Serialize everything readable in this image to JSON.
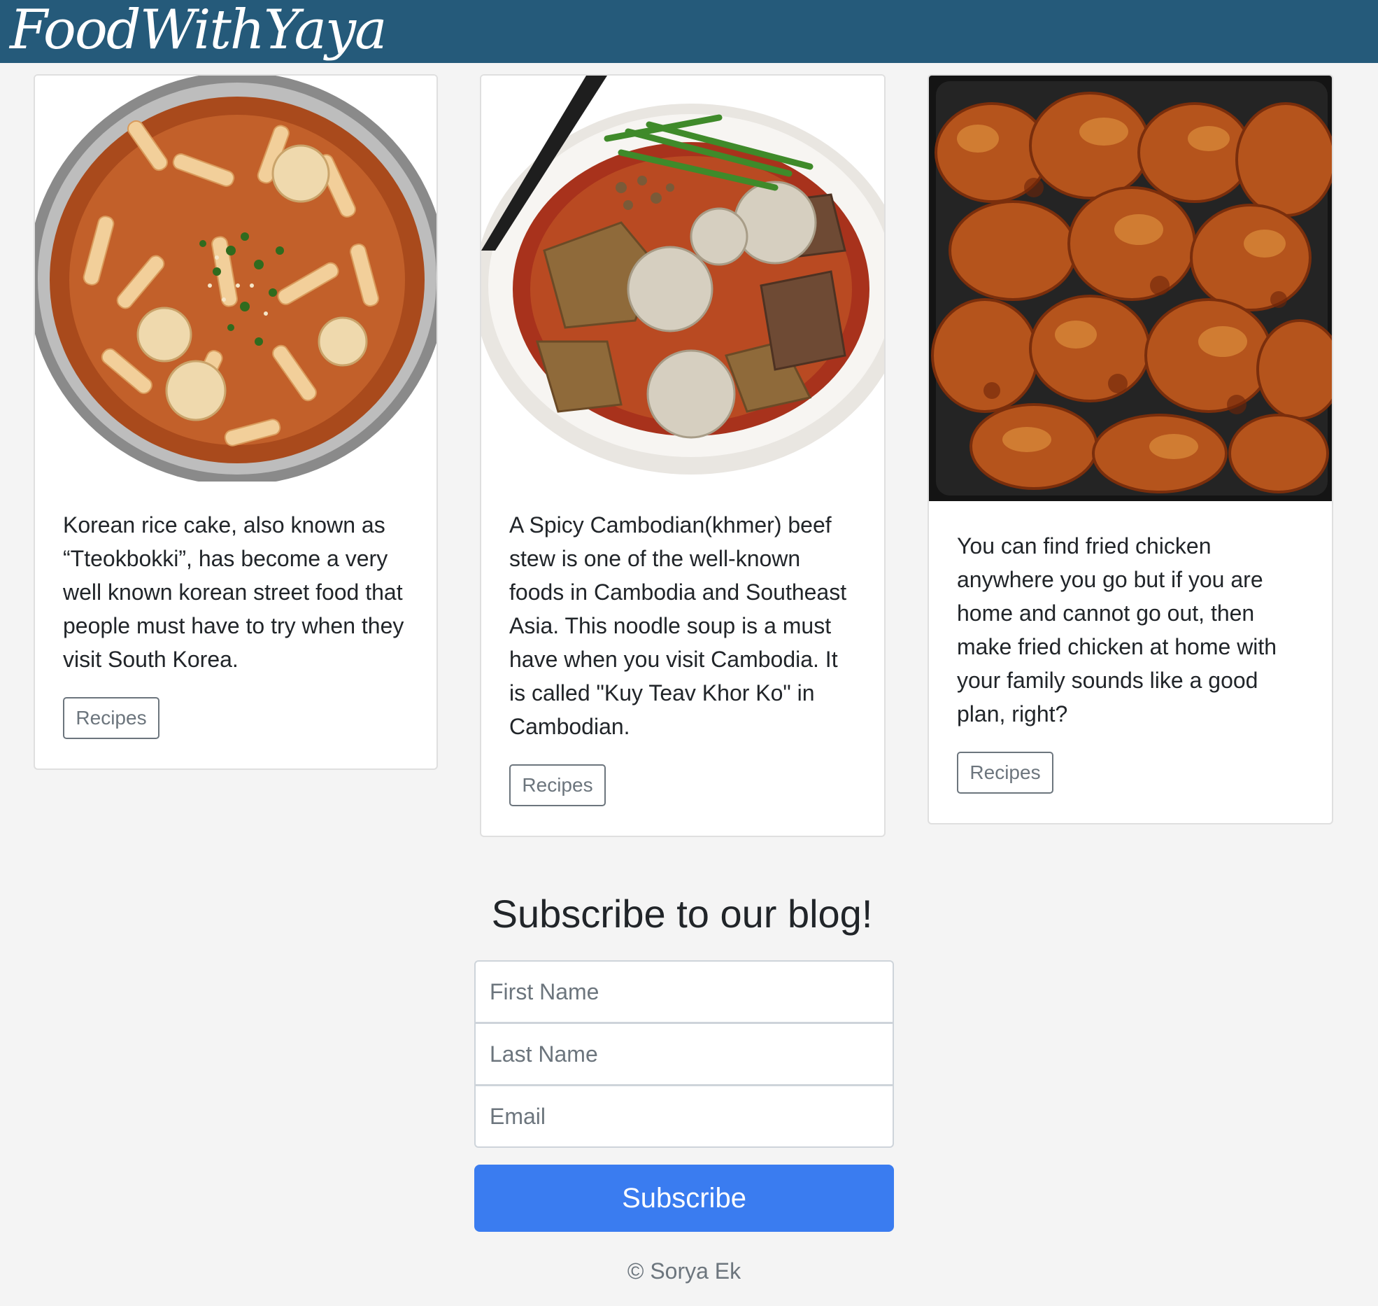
{
  "header": {
    "brand": "FoodWithYaya"
  },
  "cards": [
    {
      "image_name": "tteokbokki-image",
      "text": "Korean rice cake, also known as “Tteokbokki”, has become a very well known korean street food that people must have to try when they visit South Korea.",
      "button_label": "Recipes"
    },
    {
      "image_name": "khmer-beef-stew-image",
      "text": "A Spicy Cambodian(khmer) beef stew is one of the well-known foods in Cambodia and Southeast Asia. This noodle soup is a must have when you visit Cambodia. It is called \"Kuy Teav Khor Ko\" in Cambodian.",
      "button_label": "Recipes"
    },
    {
      "image_name": "fried-chicken-image",
      "text": "You can find fried chicken anywhere you go but if you are home and cannot go out, then make fried chicken at home with your family sounds like a good plan, right?",
      "button_label": "Recipes"
    }
  ],
  "subscribe": {
    "title": "Subscribe to our blog!",
    "first_name_placeholder": "First Name",
    "last_name_placeholder": "Last Name",
    "email_placeholder": "Email",
    "button_label": "Subscribe"
  },
  "footer": {
    "copyright": "© Sorya Ek"
  },
  "colors": {
    "navbar": "#255a7a",
    "page_background": "#f4f4f4",
    "primary_button": "#3a7cf0",
    "outline_button": "#6c757d"
  }
}
